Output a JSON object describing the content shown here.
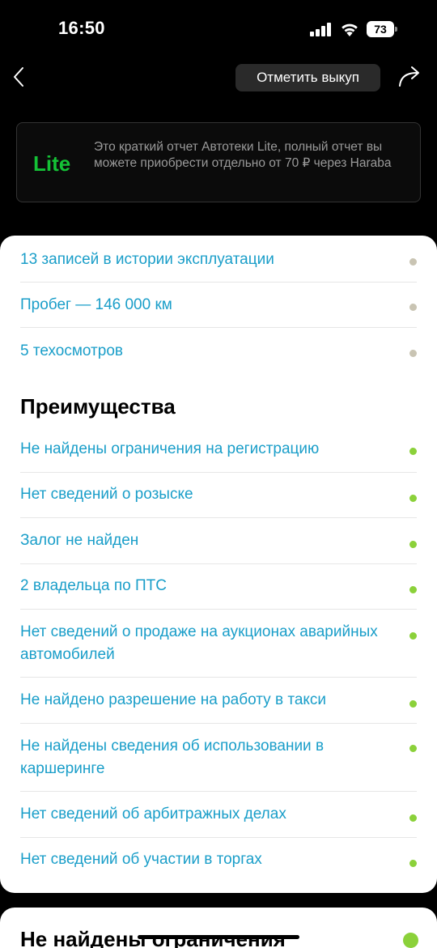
{
  "status_bar": {
    "time": "16:50",
    "battery": "73"
  },
  "header": {
    "mark_button_label": "Отметить выкуп"
  },
  "lite_banner": {
    "badge": "Lite",
    "text": "Это краткий отчет Автотеки Lite, полный отчет вы можете приобрести отдельно от 70 ₽ через Haraba"
  },
  "summary_items": [
    {
      "label": "13 записей в истории эксплуатации",
      "status": "neutral"
    },
    {
      "label": "Пробег — 146 000 км",
      "status": "neutral"
    },
    {
      "label": "5 техосмотров",
      "status": "neutral"
    }
  ],
  "advantages": {
    "heading": "Преимущества",
    "items": [
      {
        "label": "Не найдены ограничения на регистрацию",
        "status": "ok"
      },
      {
        "label": "Нет сведений о розыске",
        "status": "ok"
      },
      {
        "label": "Залог не найден",
        "status": "ok"
      },
      {
        "label": "2 владельца по ПТС",
        "status": "ok"
      },
      {
        "label": "Нет сведений о продаже на аукционах аварийных автомобилей",
        "status": "ok"
      },
      {
        "label": "Не найдено разрешение на работу в такси",
        "status": "ok"
      },
      {
        "label": "Не найдены сведения об использовании в каршеринге",
        "status": "ok"
      },
      {
        "label": "Нет сведений об арбитражных делах",
        "status": "ok"
      },
      {
        "label": "Нет сведений об участии в торгах",
        "status": "ok"
      }
    ]
  },
  "next_section": {
    "title": "Не найдены ограничения"
  },
  "colors": {
    "link": "#1a9ec9",
    "ok": "#8bd13a",
    "neutral": "#c9c4b3",
    "lite": "#14c236"
  }
}
